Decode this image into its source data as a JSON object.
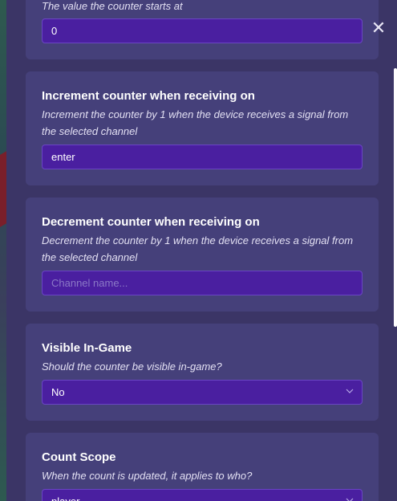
{
  "close_label": "✕",
  "fields": {
    "start_value": {
      "description": "The value the counter starts at",
      "value": "0"
    },
    "increment": {
      "title": "Increment counter when receiving on",
      "description": "Increment the counter by 1 when the device receives a signal from the selected channel",
      "value": "enter"
    },
    "decrement": {
      "title": "Decrement counter when receiving on",
      "description": "Decrement the counter by 1 when the device receives a signal from the selected channel",
      "placeholder": "Channel name..."
    },
    "visible": {
      "title": "Visible In-Game",
      "description": "Should the counter be visible in-game?",
      "value": "No"
    },
    "count_scope": {
      "title": "Count Scope",
      "description": "When the count is updated, it applies to who?",
      "value": "player"
    }
  },
  "colors": {
    "panel": "#3b3566",
    "card": "#45407a",
    "input": "#4a1fa0",
    "input_border": "#6a45c4"
  }
}
